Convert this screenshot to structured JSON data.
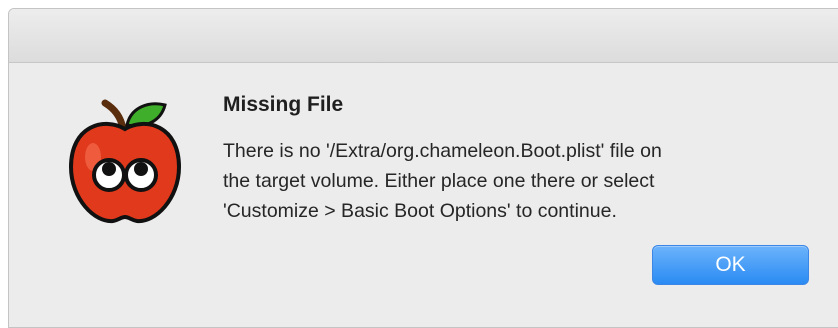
{
  "dialog": {
    "title": "Missing File",
    "message_lines": [
      "There is no '/Extra/org.chameleon.Boot.plist' file on",
      "the target volume. Either place one there or select",
      "'Customize > Basic Boot Options' to continue."
    ],
    "ok_label": "OK",
    "icon": "chameleon-apple-icon"
  },
  "colors": {
    "dialog_background": "#ececec",
    "button_accent": "#2a8bf3",
    "apple_red": "#e0391c",
    "leaf_green": "#3fae2a"
  }
}
